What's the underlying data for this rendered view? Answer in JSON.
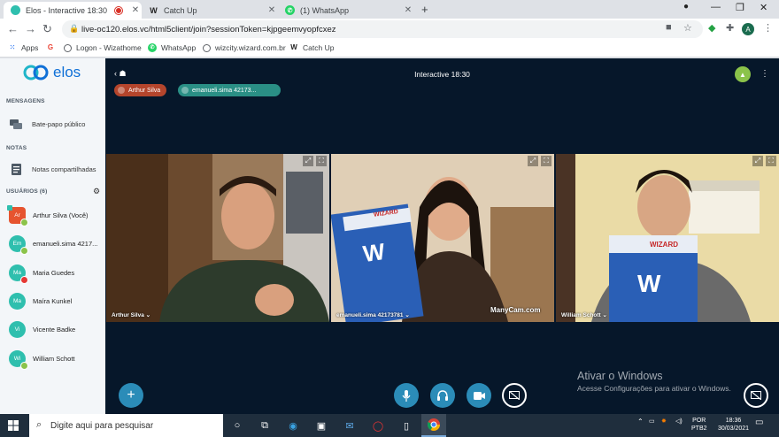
{
  "browser": {
    "tabs": [
      {
        "title": "Elos - Interactive 18:30",
        "icon": "elos-icon",
        "recording": true,
        "active": true
      },
      {
        "title": "Catch Up",
        "icon": "wizard-w-icon",
        "active": false
      },
      {
        "title": "(1) WhatsApp",
        "icon": "whatsapp-icon",
        "active": false
      }
    ],
    "url": "live-oc120.elos.vc/html5client/join?sessionToken=kjpgeemvyopfcxez",
    "profile_initial": "A",
    "bookmarks": [
      {
        "label": "Apps",
        "icon": "apps-grid-icon"
      },
      {
        "label": "",
        "icon": "google-icon"
      },
      {
        "label": "Logon - Wizathome",
        "icon": "globe-icon"
      },
      {
        "label": "WhatsApp",
        "icon": "whatsapp-icon"
      },
      {
        "label": "wizcity.wizard.com.br",
        "icon": "globe-icon"
      },
      {
        "label": "Catch Up",
        "icon": "wizard-w-icon"
      }
    ]
  },
  "sidebar": {
    "logo": "elos",
    "messages_header": "MENSAGENS",
    "public_chat": "Bate-papo público",
    "notes_header": "NOTAS",
    "shared_notes": "Notas compartilhadas",
    "users_header": "USUÁRIOS (6)",
    "users": [
      {
        "initials": "Ar",
        "name": "Arthur Silva (Você)",
        "color": "#e6542f",
        "badge": "#8bc34a",
        "me": true
      },
      {
        "initials": "Em",
        "name": "emanueli.sima 4217...",
        "color": "#2fbfae",
        "badge": "#8bc34a",
        "me": false
      },
      {
        "initials": "Ma",
        "name": "Maria Guedes",
        "color": "#2fbfae",
        "badge": "#e53935",
        "me": false
      },
      {
        "initials": "Ma",
        "name": "Maíra Kunkel",
        "color": "#2fbfae",
        "badge": "",
        "me": false
      },
      {
        "initials": "Vi",
        "name": "Vicente Badke",
        "color": "#2fbfae",
        "badge": "",
        "me": false
      },
      {
        "initials": "Wi",
        "name": "William Schott",
        "color": "#2fbfae",
        "badge": "#8bc34a",
        "me": false
      }
    ]
  },
  "main": {
    "title": "Interactive 18:30",
    "talkers": [
      {
        "name": "Arthur Silva",
        "color": "#b4452c"
      },
      {
        "name": "emanueli.sima 42173...",
        "color": "#2a8f85"
      }
    ],
    "videos": [
      {
        "name": "Arthur Silva",
        "menu": "⌄"
      },
      {
        "name": "emanueli.sima 42173781",
        "menu": "⌄",
        "overlay": "ManyCam.com"
      },
      {
        "name": "William Schott",
        "menu": "⌄"
      }
    ],
    "book_brand": "WIZARD",
    "watermark_title": "Ativar o Windows",
    "watermark_sub": "Acesse Configurações para ativar o Windows."
  },
  "taskbar": {
    "search_placeholder": "Digite aqui para pesquisar",
    "lang": "POR",
    "layout": "PTB2",
    "time": "18:36",
    "date": "30/03/2021"
  },
  "colors": {
    "accent": "#0f70d7",
    "main_bg": "#06172a",
    "control_teal": "#2b8cb8"
  }
}
